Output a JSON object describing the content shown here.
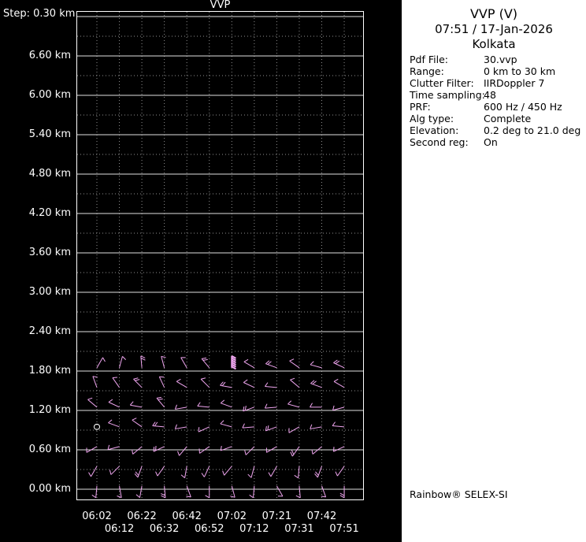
{
  "panel": {
    "title": "VVP (V)",
    "datetime": "07:51 / 17-Jan-2026",
    "site": "Kolkata",
    "fields": [
      {
        "label": "Pdf File:",
        "value": "30.vvp"
      },
      {
        "label": "Range:",
        "value": "0 km to 30 km"
      },
      {
        "label": "Clutter Filter:",
        "value": "IIRDoppler 7"
      },
      {
        "label": "Time sampling:",
        "value": "48"
      },
      {
        "label": "PRF:",
        "value": "600 Hz / 450 Hz"
      },
      {
        "label": "Alg type:",
        "value": "Complete"
      },
      {
        "label": "Elevation:",
        "value": "0.2 deg to 21.0 deg"
      },
      {
        "label": "Second reg:",
        "value": "On"
      }
    ],
    "footer": "Rainbow® SELEX-SI"
  },
  "chart_data": {
    "type": "wind-profile",
    "title": "VVP",
    "step_label": "Step: 0.30 km",
    "height_step_km": 0.3,
    "height_range_km": [
      0.0,
      7.2
    ],
    "times": [
      "06:02",
      "06:12",
      "06:22",
      "06:32",
      "06:42",
      "06:52",
      "07:02",
      "07:12",
      "07:21",
      "07:31",
      "07:42",
      "07:51"
    ],
    "y_ticks": [
      {
        "label": "6.60 km",
        "km": 6.6
      },
      {
        "label": "6.00 km",
        "km": 6.0
      },
      {
        "label": "5.40 km",
        "km": 5.4
      },
      {
        "label": "4.80 km",
        "km": 4.8
      },
      {
        "label": "4.20 km",
        "km": 4.2
      },
      {
        "label": "3.60 km",
        "km": 3.6
      },
      {
        "label": "3.00 km",
        "km": 3.0
      },
      {
        "label": "2.40 km",
        "km": 2.4
      },
      {
        "label": "1.80 km",
        "km": 1.8
      },
      {
        "label": "1.20 km",
        "km": 1.2
      },
      {
        "label": "0.60 km",
        "km": 0.6
      },
      {
        "label": "0.00 km",
        "km": 0.0
      }
    ],
    "colors": {
      "barb": "#f0a6f0",
      "grid_dotted": "#8f8f8f",
      "grid_solid": "#e0e0e0",
      "frame": "#ffffff",
      "calm": "#ffffff",
      "text": "#ffffff"
    },
    "barbs": [
      [
        0,
        1.85,
        300,
        1
      ],
      [
        1,
        1.85,
        285,
        1
      ],
      [
        2,
        1.85,
        265,
        2
      ],
      [
        3,
        1.85,
        255,
        1
      ],
      [
        4,
        1.85,
        240,
        1
      ],
      [
        5,
        1.85,
        230,
        2
      ],
      [
        6,
        1.85,
        270,
        6,
        2
      ],
      [
        7,
        1.85,
        210,
        1
      ],
      [
        8,
        1.85,
        200,
        2
      ],
      [
        9,
        1.85,
        215,
        1
      ],
      [
        10,
        1.85,
        195,
        1
      ],
      [
        11,
        1.85,
        205,
        2
      ],
      [
        0,
        1.55,
        250,
        1
      ],
      [
        1,
        1.55,
        235,
        1
      ],
      [
        2,
        1.55,
        225,
        2
      ],
      [
        3,
        1.55,
        245,
        1
      ],
      [
        4,
        1.55,
        210,
        1
      ],
      [
        5,
        1.55,
        225,
        1
      ],
      [
        6,
        1.55,
        190,
        2
      ],
      [
        7,
        1.55,
        205,
        1
      ],
      [
        8,
        1.55,
        185,
        1
      ],
      [
        9,
        1.55,
        220,
        1
      ],
      [
        10,
        1.55,
        200,
        2
      ],
      [
        11,
        1.55,
        210,
        1
      ],
      [
        0,
        1.25,
        220,
        1
      ],
      [
        1,
        1.25,
        205,
        1
      ],
      [
        2,
        1.25,
        190,
        1
      ],
      [
        3,
        1.25,
        230,
        2
      ],
      [
        4,
        1.25,
        170,
        1
      ],
      [
        5,
        1.25,
        185,
        1
      ],
      [
        6,
        1.25,
        200,
        1
      ],
      [
        7,
        1.25,
        160,
        2
      ],
      [
        8,
        1.25,
        175,
        1
      ],
      [
        9,
        1.25,
        195,
        1
      ],
      [
        10,
        1.25,
        180,
        1
      ],
      [
        11,
        1.25,
        165,
        1
      ],
      [
        1,
        0.95,
        200,
        1
      ],
      [
        2,
        0.95,
        215,
        1
      ],
      [
        3,
        0.95,
        185,
        2
      ],
      [
        4,
        0.95,
        170,
        1
      ],
      [
        5,
        0.95,
        155,
        1
      ],
      [
        6,
        0.95,
        195,
        1
      ],
      [
        7,
        0.95,
        175,
        1
      ],
      [
        8,
        0.95,
        160,
        2
      ],
      [
        9,
        0.95,
        150,
        1
      ],
      [
        10,
        0.95,
        170,
        1
      ],
      [
        11,
        0.95,
        185,
        1
      ],
      [
        0,
        0.65,
        150,
        1
      ],
      [
        1,
        0.65,
        165,
        1
      ],
      [
        2,
        0.65,
        140,
        1
      ],
      [
        3,
        0.65,
        155,
        2
      ],
      [
        4,
        0.65,
        130,
        1
      ],
      [
        5,
        0.65,
        145,
        1
      ],
      [
        6,
        0.65,
        160,
        1
      ],
      [
        7,
        0.65,
        135,
        1
      ],
      [
        8,
        0.65,
        150,
        1
      ],
      [
        9,
        0.65,
        125,
        2
      ],
      [
        10,
        0.65,
        140,
        1
      ],
      [
        11,
        0.65,
        155,
        1
      ],
      [
        0,
        0.35,
        120,
        1
      ],
      [
        1,
        0.35,
        135,
        1
      ],
      [
        2,
        0.35,
        110,
        2
      ],
      [
        3,
        0.35,
        125,
        1
      ],
      [
        4,
        0.35,
        100,
        1
      ],
      [
        5,
        0.35,
        115,
        1
      ],
      [
        6,
        0.35,
        130,
        1
      ],
      [
        7,
        0.35,
        105,
        1
      ],
      [
        8,
        0.35,
        120,
        1
      ],
      [
        9,
        0.35,
        95,
        1
      ],
      [
        10,
        0.35,
        110,
        2
      ],
      [
        11,
        0.35,
        125,
        1
      ],
      [
        0,
        0.05,
        95,
        1
      ],
      [
        1,
        0.05,
        80,
        1
      ],
      [
        2,
        0.05,
        100,
        1
      ],
      [
        3,
        0.05,
        85,
        2
      ],
      [
        4,
        0.05,
        70,
        1
      ],
      [
        5,
        0.05,
        90,
        1
      ],
      [
        6,
        0.05,
        75,
        1
      ],
      [
        7,
        0.05,
        95,
        1
      ],
      [
        8,
        0.05,
        60,
        1
      ],
      [
        9,
        0.05,
        85,
        1
      ],
      [
        10,
        0.05,
        70,
        1
      ],
      [
        11,
        0.05,
        90,
        2
      ]
    ],
    "calm_circles": [
      [
        0,
        0.95
      ]
    ]
  }
}
